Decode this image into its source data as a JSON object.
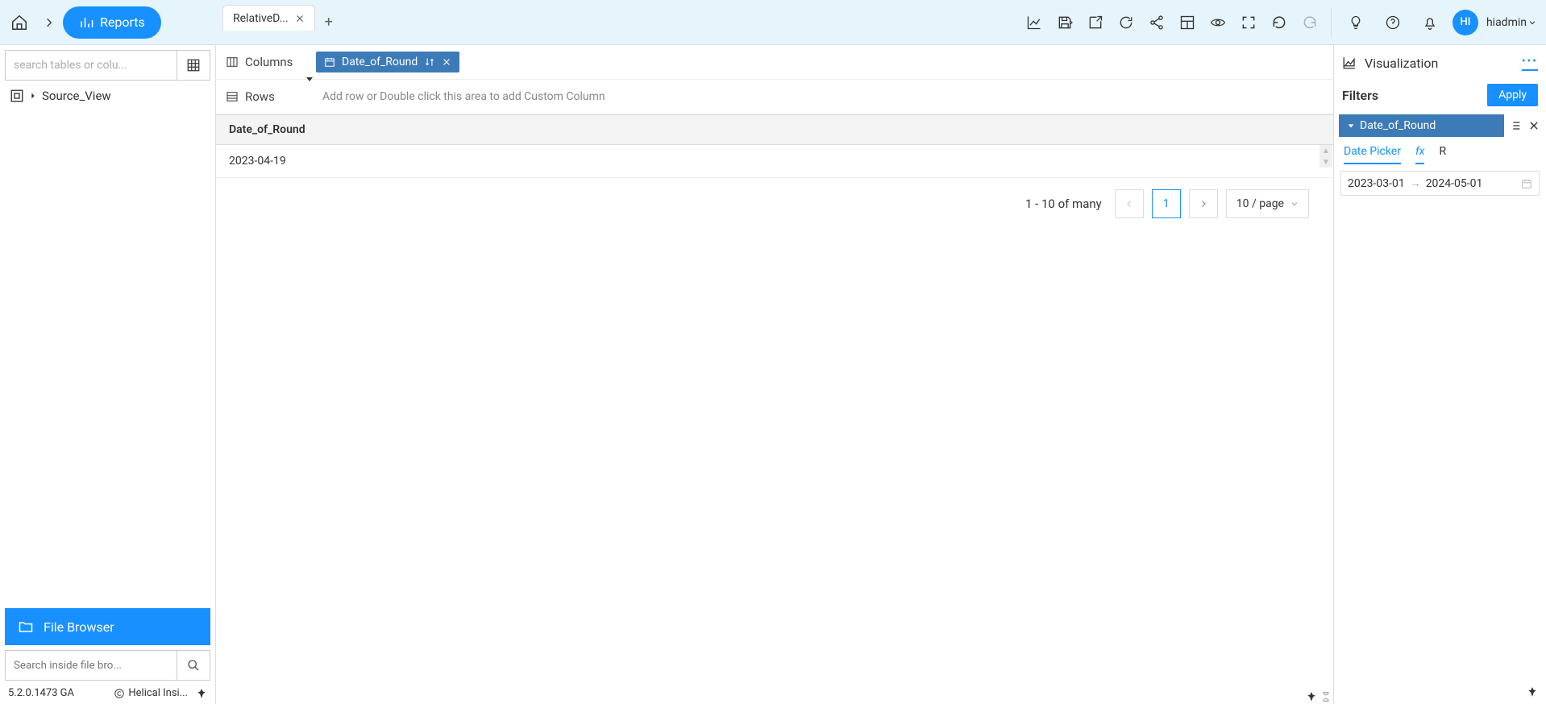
{
  "header": {
    "reports_label": "Reports",
    "tab_label": "RelativeD...",
    "username": "hiadmin",
    "avatar": "HI"
  },
  "sidebar": {
    "search_placeholder": "search tables or colu...",
    "tree_item": "Source_View",
    "file_browser_label": "File Browser",
    "file_search_placeholder": "Search inside file bro...",
    "version": "5.2.0.1473 GA",
    "copyright": "Helical Insi..."
  },
  "shelves": {
    "columns_label": "Columns",
    "rows_label": "Rows",
    "column_pill": "Date_of_Round",
    "rows_placeholder": "Add row or Double click this area to add Custom Column"
  },
  "table": {
    "header": "Date_of_Round",
    "rows": [
      "2023-04-19"
    ]
  },
  "pagination": {
    "info": "1 - 10 of many",
    "current": "1",
    "page_size": "10 / page"
  },
  "right": {
    "viz_label": "Visualization",
    "filters_label": "Filters",
    "apply_label": "Apply",
    "filter_chip": "Date_of_Round",
    "tabs": {
      "date_picker": "Date Picker",
      "fx": "fx",
      "r": "R"
    },
    "date_from": "2023-03-01",
    "date_to": "2024-05-01"
  }
}
